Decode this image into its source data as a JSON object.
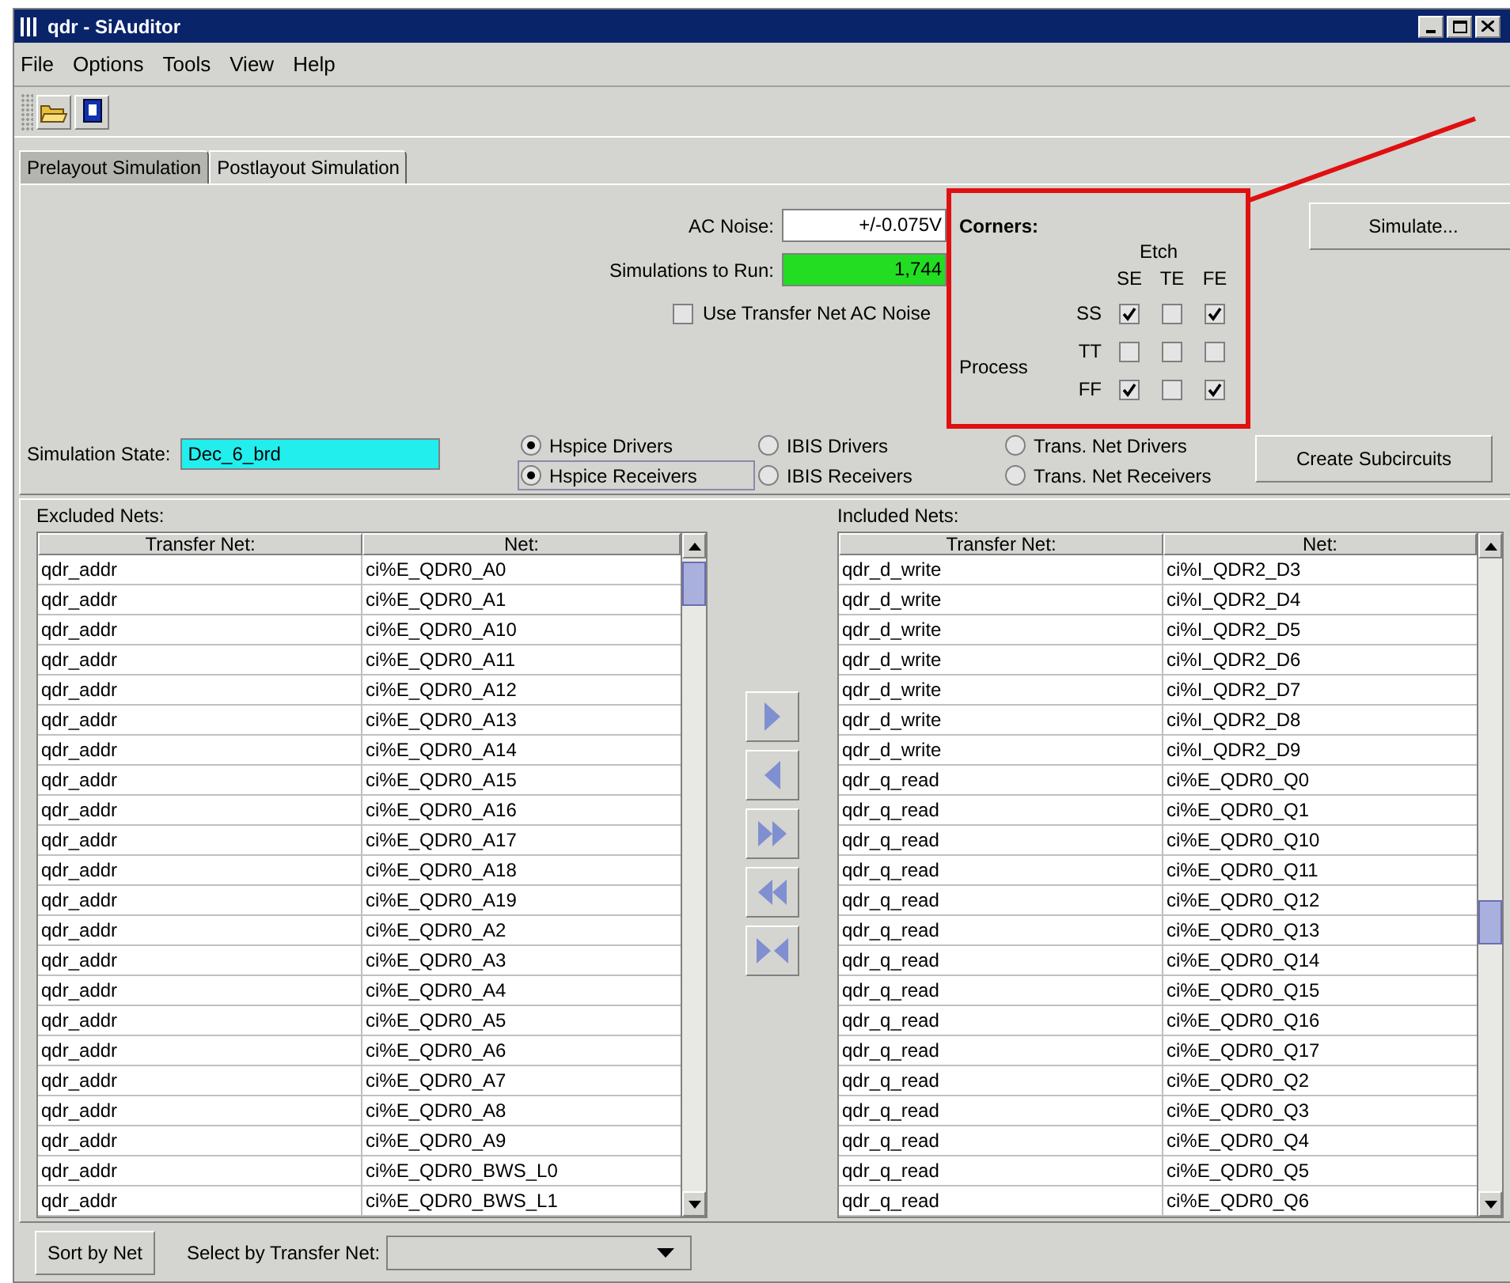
{
  "window": {
    "title": "qdr - SiAuditor"
  },
  "menu": [
    "File",
    "Options",
    "Tools",
    "View",
    "Help"
  ],
  "tabs": [
    {
      "label": "Prelayout Simulation",
      "selected": true
    },
    {
      "label": "Postlayout Simulation",
      "selected": false
    }
  ],
  "settings": {
    "ac_noise": {
      "label": "AC Noise:",
      "value": "+/-0.075V"
    },
    "simulations_to_run": {
      "label": "Simulations to Run:",
      "value": "1,744"
    },
    "use_transfer_net_ac_noise": {
      "label": "Use Transfer Net AC Noise",
      "checked": false
    }
  },
  "corners": {
    "title": "Corners:",
    "etch_label": "Etch",
    "process_label": "Process",
    "columns": [
      "SE",
      "TE",
      "FE"
    ],
    "rows": [
      {
        "label": "SS",
        "cells": [
          {
            "checked": true
          },
          {
            "checked": false
          },
          {
            "checked": true
          }
        ]
      },
      {
        "label": "TT",
        "cells": [
          {
            "checked": false
          },
          {
            "checked": false
          },
          {
            "checked": false
          }
        ]
      },
      {
        "label": "FF",
        "cells": [
          {
            "checked": true
          },
          {
            "checked": false
          },
          {
            "checked": true
          }
        ]
      }
    ]
  },
  "simulate_button": "Simulate...",
  "simulation_state": {
    "label": "Simulation State:",
    "value": "Dec_6_brd"
  },
  "driver_options": [
    {
      "label": "Hspice Drivers",
      "selected": true,
      "focused": false
    },
    {
      "label": "IBIS Drivers",
      "selected": false,
      "focused": false
    },
    {
      "label": "Trans. Net Drivers",
      "selected": false,
      "focused": false
    }
  ],
  "receiver_options": [
    {
      "label": "Hspice Receivers",
      "selected": true,
      "focused": true
    },
    {
      "label": "IBIS Receivers",
      "selected": false,
      "focused": false
    },
    {
      "label": "Trans. Net Receivers",
      "selected": false,
      "focused": false
    }
  ],
  "create_subcircuits_button": "Create Subcircuits",
  "excluded_nets": {
    "title": "Excluded Nets:",
    "columns": [
      "Transfer Net:",
      "Net:"
    ],
    "rows": [
      [
        "qdr_addr",
        "ci%E_QDR0_A0"
      ],
      [
        "qdr_addr",
        "ci%E_QDR0_A1"
      ],
      [
        "qdr_addr",
        "ci%E_QDR0_A10"
      ],
      [
        "qdr_addr",
        "ci%E_QDR0_A11"
      ],
      [
        "qdr_addr",
        "ci%E_QDR0_A12"
      ],
      [
        "qdr_addr",
        "ci%E_QDR0_A13"
      ],
      [
        "qdr_addr",
        "ci%E_QDR0_A14"
      ],
      [
        "qdr_addr",
        "ci%E_QDR0_A15"
      ],
      [
        "qdr_addr",
        "ci%E_QDR0_A16"
      ],
      [
        "qdr_addr",
        "ci%E_QDR0_A17"
      ],
      [
        "qdr_addr",
        "ci%E_QDR0_A18"
      ],
      [
        "qdr_addr",
        "ci%E_QDR0_A19"
      ],
      [
        "qdr_addr",
        "ci%E_QDR0_A2"
      ],
      [
        "qdr_addr",
        "ci%E_QDR0_A3"
      ],
      [
        "qdr_addr",
        "ci%E_QDR0_A4"
      ],
      [
        "qdr_addr",
        "ci%E_QDR0_A5"
      ],
      [
        "qdr_addr",
        "ci%E_QDR0_A6"
      ],
      [
        "qdr_addr",
        "ci%E_QDR0_A7"
      ],
      [
        "qdr_addr",
        "ci%E_QDR0_A8"
      ],
      [
        "qdr_addr",
        "ci%E_QDR0_A9"
      ],
      [
        "qdr_addr",
        "ci%E_QDR0_BWS_L0"
      ],
      [
        "qdr_addr",
        "ci%E_QDR0_BWS_L1"
      ]
    ]
  },
  "included_nets": {
    "title": "Included Nets:",
    "columns": [
      "Transfer Net:",
      "Net:"
    ],
    "rows": [
      [
        "qdr_d_write",
        "ci%I_QDR2_D3"
      ],
      [
        "qdr_d_write",
        "ci%I_QDR2_D4"
      ],
      [
        "qdr_d_write",
        "ci%I_QDR2_D5"
      ],
      [
        "qdr_d_write",
        "ci%I_QDR2_D6"
      ],
      [
        "qdr_d_write",
        "ci%I_QDR2_D7"
      ],
      [
        "qdr_d_write",
        "ci%I_QDR2_D8"
      ],
      [
        "qdr_d_write",
        "ci%I_QDR2_D9"
      ],
      [
        "qdr_q_read",
        "ci%E_QDR0_Q0"
      ],
      [
        "qdr_q_read",
        "ci%E_QDR0_Q1"
      ],
      [
        "qdr_q_read",
        "ci%E_QDR0_Q10"
      ],
      [
        "qdr_q_read",
        "ci%E_QDR0_Q11"
      ],
      [
        "qdr_q_read",
        "ci%E_QDR0_Q12"
      ],
      [
        "qdr_q_read",
        "ci%E_QDR0_Q13"
      ],
      [
        "qdr_q_read",
        "ci%E_QDR0_Q14"
      ],
      [
        "qdr_q_read",
        "ci%E_QDR0_Q15"
      ],
      [
        "qdr_q_read",
        "ci%E_QDR0_Q16"
      ],
      [
        "qdr_q_read",
        "ci%E_QDR0_Q17"
      ],
      [
        "qdr_q_read",
        "ci%E_QDR0_Q2"
      ],
      [
        "qdr_q_read",
        "ci%E_QDR0_Q3"
      ],
      [
        "qdr_q_read",
        "ci%E_QDR0_Q4"
      ],
      [
        "qdr_q_read",
        "ci%E_QDR0_Q5"
      ],
      [
        "qdr_q_read",
        "ci%E_QDR0_Q6"
      ]
    ]
  },
  "sort_button": "Sort by Net",
  "select_by_transfer_net": {
    "label": "Select by Transfer Net:"
  }
}
